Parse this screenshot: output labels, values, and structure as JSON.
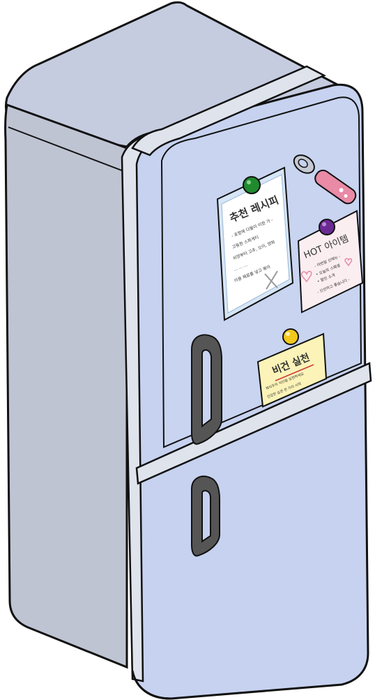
{
  "colors": {
    "fridge_top": "#c5ccdf",
    "fridge_side": "#bfc4d3",
    "fridge_front": "#c6d2ef",
    "fridge_band": "#dfe3ec",
    "outline": "#111111",
    "handle": "#555555",
    "pin_green": "#1f8a2e",
    "pin_purple": "#6b2a93",
    "pin_yellow": "#f2c81c",
    "note_blue_bg": "#d6e6f7",
    "note_pink_bg": "#fbeef1",
    "note_yellow_bg": "#fbf3b8",
    "opener_pink": "#e98aa7"
  },
  "icons": [
    "bottle-opener-icon",
    "push-pin-icon",
    "fork-knife-icon",
    "heart-icon"
  ],
  "notes": {
    "recipe": {
      "title": "추천 레시피",
      "lines": [
        "- 포항에 다물이 이현 가 -",
        "고등한 스파게티",
        "쇠양부터 고추, 오이, 양파",
        "... ... ...",
        "이용 재료를 넣고 볶아"
      ]
    },
    "hot": {
      "title": "HOT 아이템",
      "lines": [
        "- 이번달 신메뉴 -",
        "• 오늘의 스페셜",
        "• 할인 소개",
        "- 신선하고 좋습니다 -"
      ]
    },
    "vegan": {
      "title": "비건 실천",
      "lines": [
        "채식주의 식단을 실천하세요",
        "건강한 습관 한 가지 시작"
      ]
    }
  }
}
